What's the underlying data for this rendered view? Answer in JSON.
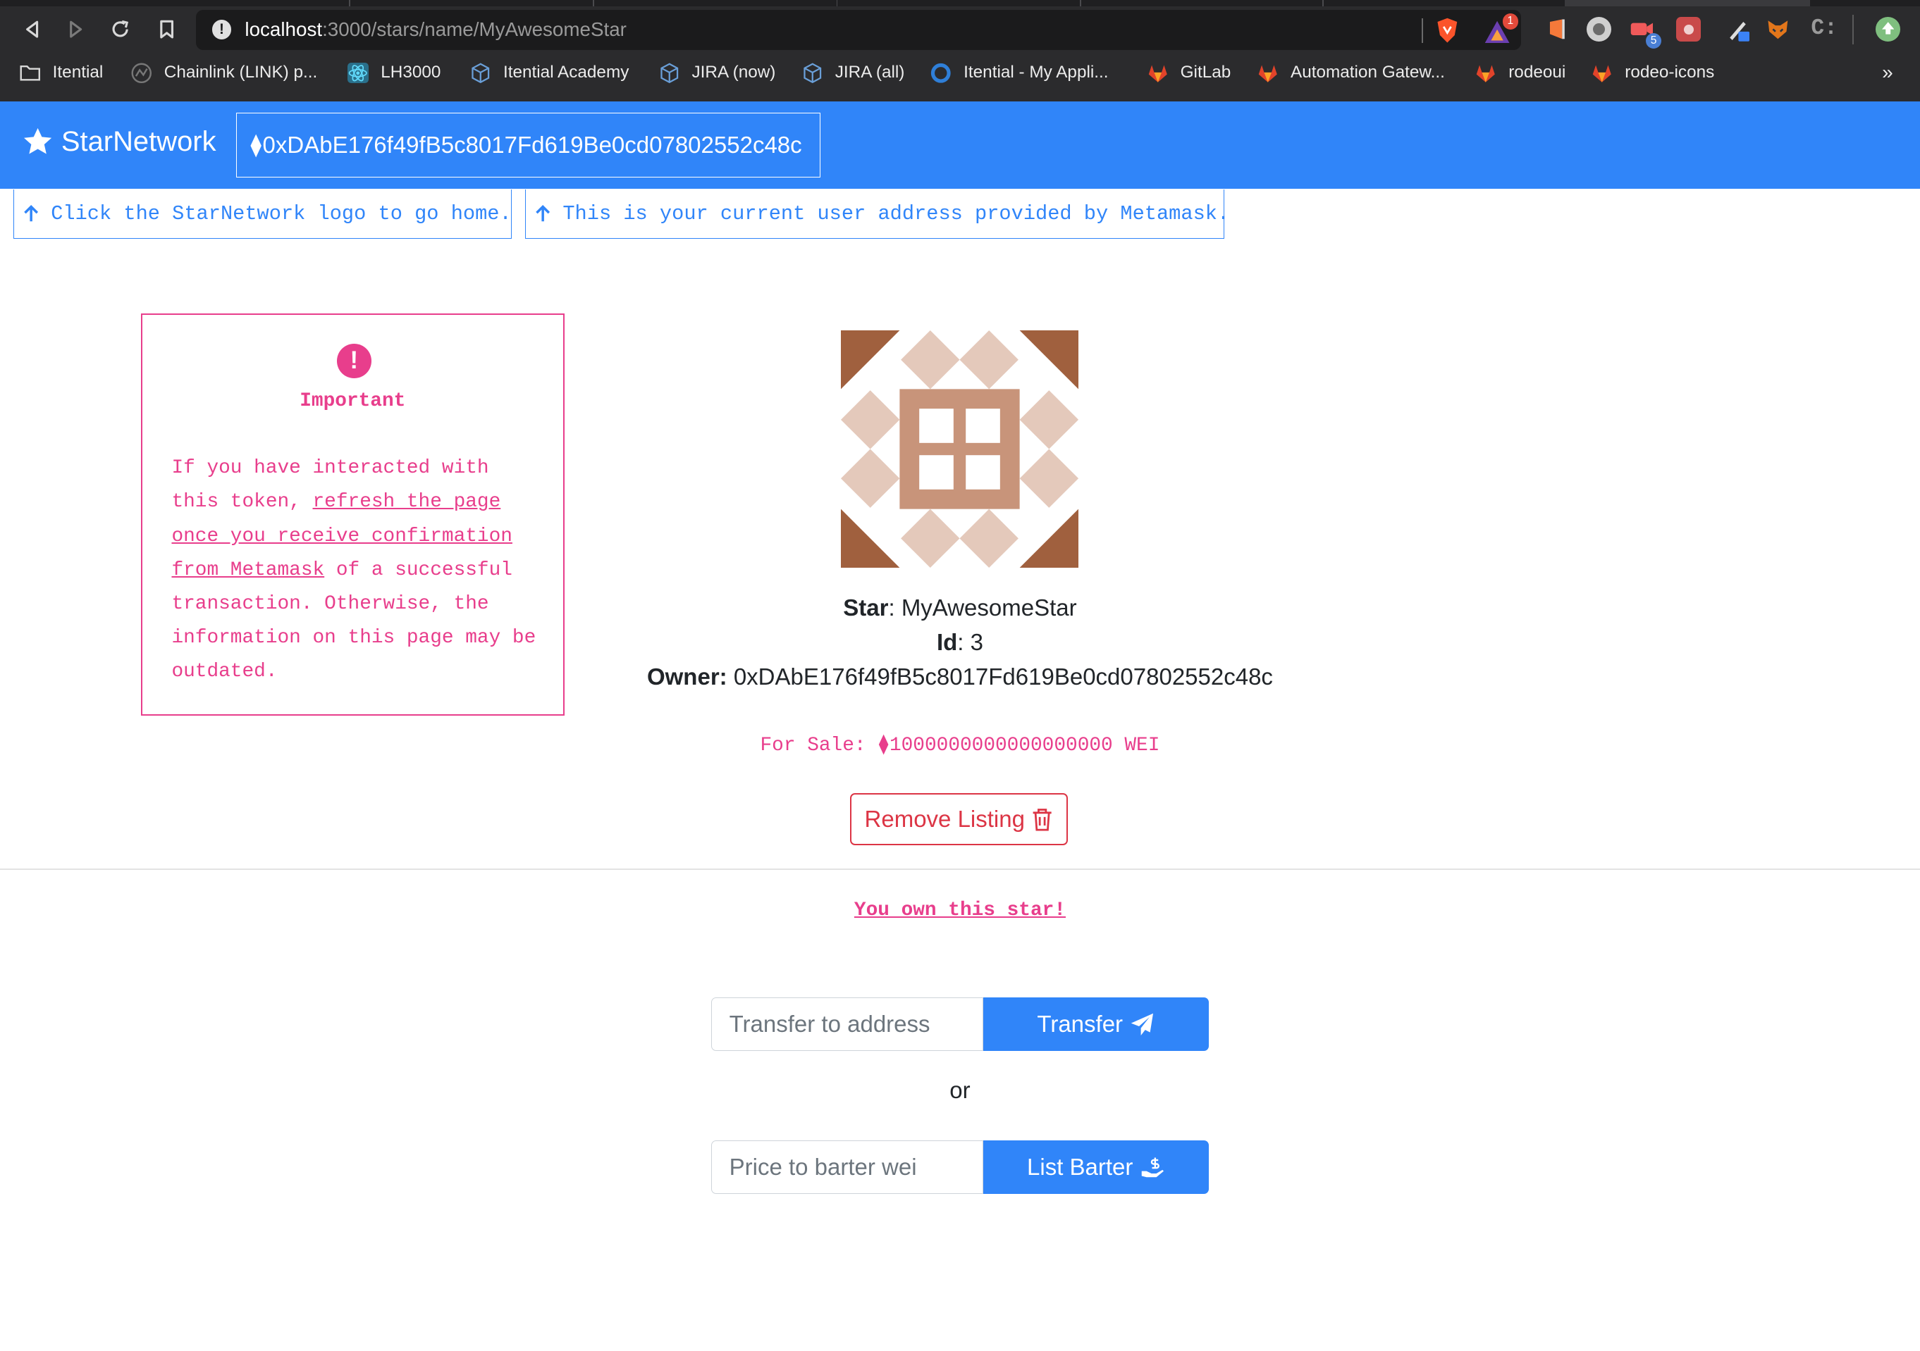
{
  "browser": {
    "url_host": "localhost",
    "url_path": ":3000/stars/name/MyAwesomeStar",
    "extension_badges": [
      "1",
      "5"
    ],
    "bookmarks": [
      {
        "label": "Itential",
        "icon": "folder-icon"
      },
      {
        "label": "Chainlink (LINK) p...",
        "icon": "chainlink-icon"
      },
      {
        "label": "LH3000",
        "icon": "react-icon"
      },
      {
        "label": "Itential Academy",
        "icon": "cube-icon"
      },
      {
        "label": "JIRA (now)",
        "icon": "cube-icon"
      },
      {
        "label": "JIRA (all)",
        "icon": "cube-icon"
      },
      {
        "label": "Itential - My Appli...",
        "icon": "circle-icon"
      },
      {
        "label": "GitLab",
        "icon": "gitlab-icon"
      },
      {
        "label": "Automation Gatew...",
        "icon": "gitlab-icon"
      },
      {
        "label": "rodeoui",
        "icon": "gitlab-icon"
      },
      {
        "label": "rodeo-icons",
        "icon": "gitlab-icon"
      }
    ],
    "more_label": "»"
  },
  "nav": {
    "brand": "StarNetwork",
    "eth_symbol": "⧫",
    "address": "0xDAbE176f49fB5c8017Fd619Be0cd07802552c48c"
  },
  "hints": {
    "home": "Click the StarNetwork logo to go home.",
    "address": "This is your current user address provided by Metamask."
  },
  "important": {
    "icon_glyph": "!",
    "title": "Important",
    "text_before": "If you have interacted with this token, ",
    "link": "refresh the page once you receive confirmation from Metamask",
    "text_after": " of a successful transaction. Otherwise, the information on this page may be outdated."
  },
  "star": {
    "star_label": "Star",
    "name": ": MyAwesomeStar",
    "id_label": "Id",
    "id": ": 3",
    "owner_label": "Owner:",
    "owner": " 0xDAbE176f49fB5c8017Fd619Be0cd07802552c48c",
    "for_sale": "For Sale: ⧫1000000000000000000 WEI",
    "art_colors": {
      "dark": "#a0603e",
      "mid": "#c8947a",
      "light": "#e4c9bb"
    }
  },
  "actions": {
    "remove_label": "Remove Listing",
    "own_text": "You own this star!",
    "transfer_placeholder": "Transfer to address",
    "transfer_label": "Transfer",
    "or_text": "or",
    "barter_placeholder": "Price to barter wei",
    "barter_label": "List Barter"
  },
  "colors": {
    "primary": "#3085f9",
    "pink": "#e83e8c",
    "danger": "#dc3545"
  }
}
